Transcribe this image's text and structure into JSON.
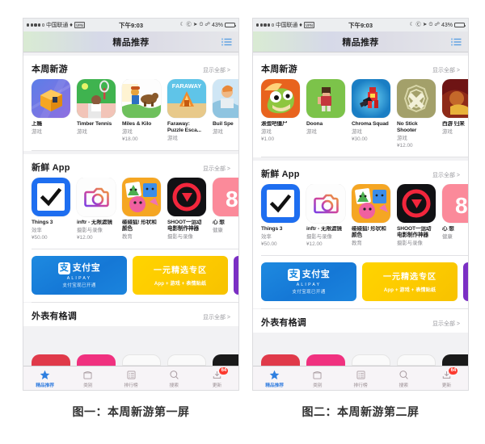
{
  "figures": [
    {
      "caption": "图一：本周新游第一屏",
      "status": {
        "carrier": "中国联通",
        "wifi_icon": "wifi-icon",
        "vpn_label": "VPN",
        "time": "下午9:03",
        "moon_icon": "do-not-disturb-icon",
        "lock_icon": "rotation-lock-icon",
        "location_icon": "location-arrow-icon",
        "alarm_icon": "alarm-clock-icon",
        "bluetooth_icon": "bluetooth-icon",
        "battery_pct": "43%"
      },
      "nav": {
        "title": "精品推荐",
        "right_icon": "wishlist-icon"
      },
      "sections": [
        {
          "title": "本周新游",
          "more": "显示全部 >",
          "apps": [
            {
              "name": "上瘾",
              "cat": "游戏",
              "price": "",
              "icon": "app-icon-shangyin"
            },
            {
              "name": "Timber Tennis",
              "cat": "游戏",
              "price": "",
              "icon": "app-icon-timber-tennis"
            },
            {
              "name": "Miles & Kilo",
              "cat": "游戏",
              "price": "¥18.00",
              "icon": "app-icon-miles-kilo"
            },
            {
              "name": "Faraway: Puzzle Esca...",
              "cat": "游戏",
              "price": "",
              "icon": "app-icon-faraway"
            },
            {
              "name": "Buil Spe",
              "cat": "游戏",
              "price": "",
              "icon": "app-icon-builder-clipped"
            }
          ]
        },
        {
          "title": "新鲜 App",
          "more": "显示全部 >",
          "apps": [
            {
              "name": "Things 3",
              "cat": "效率",
              "price": "¥50.00",
              "icon": "app-icon-things3"
            },
            {
              "name": "inftr - 无限滤镜",
              "cat": "摄影与录像",
              "price": "¥12.00",
              "icon": "app-icon-inftr"
            },
            {
              "name": "碰碰狐! 形状和颜色",
              "cat": "教育",
              "price": "",
              "icon": "app-icon-pinkfong"
            },
            {
              "name": "SHOOT一运动电影制作神器",
              "cat": "摄影与录像",
              "price": "",
              "icon": "app-icon-shoot"
            },
            {
              "name": "心 想",
              "cat": "健康",
              "price": "",
              "icon": "app-icon-health-clipped"
            }
          ]
        }
      ],
      "banners": {
        "alipay": {
          "mark": "支",
          "word": "支付宝",
          "sub_en": "ALIPAY",
          "sub_cn": "支付宝现已开通"
        },
        "yuan": {
          "line1": "一元精选专区",
          "line2": "App + 游戏 + 表情贴纸"
        },
        "third": {
          "icon": "train-banner-icon"
        }
      },
      "bottom_section": {
        "title": "外表有格调",
        "more": "显示全部 >"
      },
      "tabs": [
        {
          "label": "精品推荐",
          "icon": "star-icon",
          "active": true,
          "badge": ""
        },
        {
          "label": "类别",
          "icon": "category-box-icon",
          "active": false,
          "badge": ""
        },
        {
          "label": "排行榜",
          "icon": "ranking-list-icon",
          "active": false,
          "badge": ""
        },
        {
          "label": "搜索",
          "icon": "search-icon",
          "active": false,
          "badge": ""
        },
        {
          "label": "更新",
          "icon": "download-update-icon",
          "active": false,
          "badge": "64"
        }
      ]
    },
    {
      "caption": "图二：本周新游第二屏",
      "status": {
        "carrier": "中国联通",
        "wifi_icon": "wifi-icon",
        "vpn_label": "VPN",
        "time": "下午9:03",
        "moon_icon": "do-not-disturb-icon",
        "lock_icon": "rotation-lock-icon",
        "location_icon": "location-arrow-icon",
        "alarm_icon": "alarm-clock-icon",
        "bluetooth_icon": "bluetooth-icon",
        "battery_pct": "43%"
      },
      "nav": {
        "title": "精品推荐",
        "right_icon": "wishlist-icon"
      },
      "sections": [
        {
          "title": "本周新游",
          "more": "显示全部 >",
          "apps": [
            {
              "name": "滚蛋吧僵尸",
              "cat": "游戏",
              "price": "¥1.00",
              "icon": "app-icon-gundanba-zombie"
            },
            {
              "name": "Doona",
              "cat": "游戏",
              "price": "",
              "icon": "app-icon-doona"
            },
            {
              "name": "Chroma Squad",
              "cat": "游戏",
              "price": "¥30.00",
              "icon": "app-icon-chroma-squad"
            },
            {
              "name": "No Stick Shooter",
              "cat": "游戏",
              "price": "¥12.00",
              "icon": "app-icon-no-stick-shooter"
            },
            {
              "name": "西游 归来",
              "cat": "游戏",
              "price": "",
              "icon": "app-icon-xiyou-clipped"
            }
          ]
        },
        {
          "title": "新鲜 App",
          "more": "显示全部 >",
          "apps": [
            {
              "name": "Things 3",
              "cat": "效率",
              "price": "¥50.00",
              "icon": "app-icon-things3"
            },
            {
              "name": "inftr - 无限滤镜",
              "cat": "摄影与录像",
              "price": "¥12.00",
              "icon": "app-icon-inftr"
            },
            {
              "name": "碰碰狐! 形状和颜色",
              "cat": "教育",
              "price": "",
              "icon": "app-icon-pinkfong"
            },
            {
              "name": "SHOOT一运动电影制作神器",
              "cat": "摄影与录像",
              "price": "",
              "icon": "app-icon-shoot"
            },
            {
              "name": "心 想",
              "cat": "健康",
              "price": "",
              "icon": "app-icon-health-clipped"
            }
          ]
        }
      ],
      "banners": {
        "alipay": {
          "mark": "支",
          "word": "支付宝",
          "sub_en": "ALIPAY",
          "sub_cn": "支付宝现已开通"
        },
        "yuan": {
          "line1": "一元精选专区",
          "line2": "App + 游戏 + 表情贴纸"
        },
        "third": {
          "icon": "train-banner-icon"
        }
      },
      "bottom_section": {
        "title": "外表有格调",
        "more": "显示全部 >"
      },
      "tabs": [
        {
          "label": "精品推荐",
          "icon": "star-icon",
          "active": true,
          "badge": ""
        },
        {
          "label": "类别",
          "icon": "category-box-icon",
          "active": false,
          "badge": ""
        },
        {
          "label": "排行榜",
          "icon": "ranking-list-icon",
          "active": false,
          "badge": ""
        },
        {
          "label": "搜索",
          "icon": "search-icon",
          "active": false,
          "badge": ""
        },
        {
          "label": "更新",
          "icon": "download-update-icon",
          "active": false,
          "badge": "64"
        }
      ]
    }
  ],
  "colors": {
    "accent_blue": "#3b82e0",
    "badge_red": "#fc3b30",
    "alipay_blue": "#1284dd",
    "yuan_yellow": "#ffd400",
    "gray_text": "#8e8e93",
    "phone_bg": "#f2f2f4"
  }
}
